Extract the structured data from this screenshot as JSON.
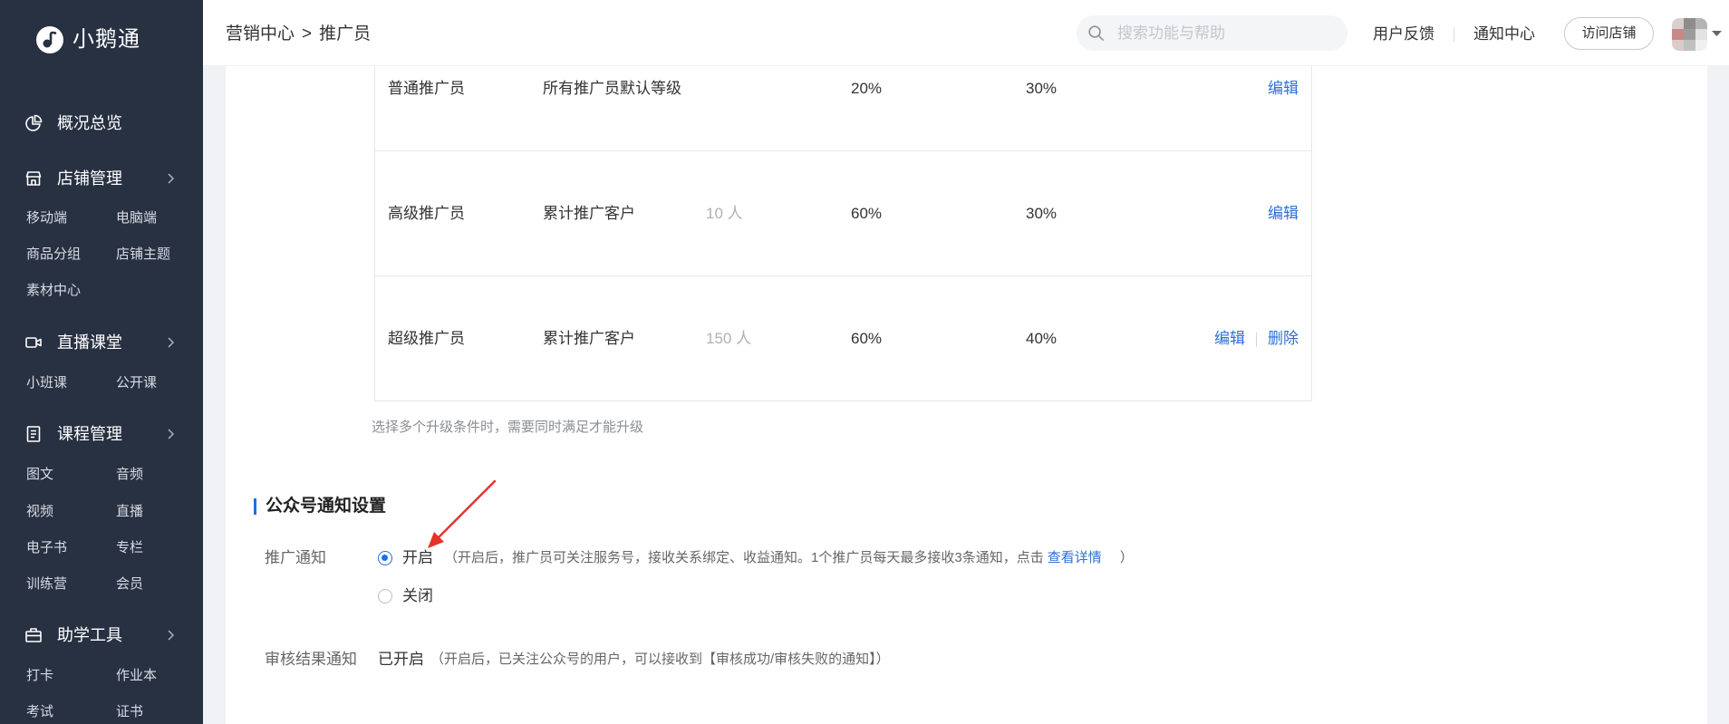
{
  "brand": {
    "name": "小鹅通",
    "logo_icon": "swan-logo-icon"
  },
  "sidebar": {
    "overview": {
      "label": "概况总览",
      "icon": "pie-chart-icon"
    },
    "store": {
      "label": "店铺管理",
      "icon": "store-icon",
      "items": [
        "移动端",
        "电脑端",
        "商品分组",
        "店铺主题",
        "素材中心"
      ]
    },
    "live": {
      "label": "直播课堂",
      "icon": "video-camera-icon",
      "items": [
        "小班课",
        "公开课"
      ]
    },
    "course": {
      "label": "课程管理",
      "icon": "book-icon",
      "items": [
        "图文",
        "音频",
        "视频",
        "直播",
        "电子书",
        "专栏",
        "训练营",
        "会员"
      ]
    },
    "tools": {
      "label": "助学工具",
      "icon": "toolbox-icon",
      "items": [
        "打卡",
        "作业本",
        "考试",
        "证书"
      ]
    }
  },
  "header": {
    "breadcrumb": {
      "parent": "营销中心",
      "separator": ">",
      "current": "推广员"
    },
    "search_placeholder": "搜索功能与帮助",
    "feedback": "用户反馈",
    "notifications": "通知中心",
    "visit_store": "访问店铺"
  },
  "levels": {
    "rows": [
      {
        "name": "普通推广员",
        "condition": "所有推广员默认等级",
        "rate_a": "20%",
        "rate_b": "30%",
        "actions": [
          "编辑"
        ]
      },
      {
        "name": "高级推广员",
        "condition": "累计推广客户",
        "threshold": "10 人",
        "rate_a": "60%",
        "rate_b": "30%",
        "actions": [
          "编辑"
        ]
      },
      {
        "name": "超级推广员",
        "condition": "累计推广客户",
        "threshold": "150 人",
        "rate_a": "60%",
        "rate_b": "40%",
        "actions": [
          "编辑",
          "删除"
        ]
      }
    ],
    "note": "选择多个升级条件时，需要同时满足才能升级"
  },
  "wechat_notify": {
    "title": "公众号通知设置",
    "promo": {
      "label": "推广通知",
      "options": [
        "开启",
        "关闭"
      ],
      "selected_index": 0,
      "hint_prefix": "（开启后，推广员可关注服务号，接收关系绑定、收益通知。1个推广员每天最多接收3条通知，点击",
      "hint_link": "查看详情",
      "hint_suffix": "）"
    },
    "review": {
      "label": "审核结果通知",
      "status": "已开启",
      "hint": "（开启后，已关注公众号的用户，可以接收到【审核成功/审核失败的通知】）"
    }
  },
  "colors": {
    "sidebar_bg": "#283142",
    "accent": "#1f6fe0",
    "link": "#2f6fd6",
    "annotation_arrow": "#e5332a",
    "page_bg": "#f0f2f5"
  }
}
